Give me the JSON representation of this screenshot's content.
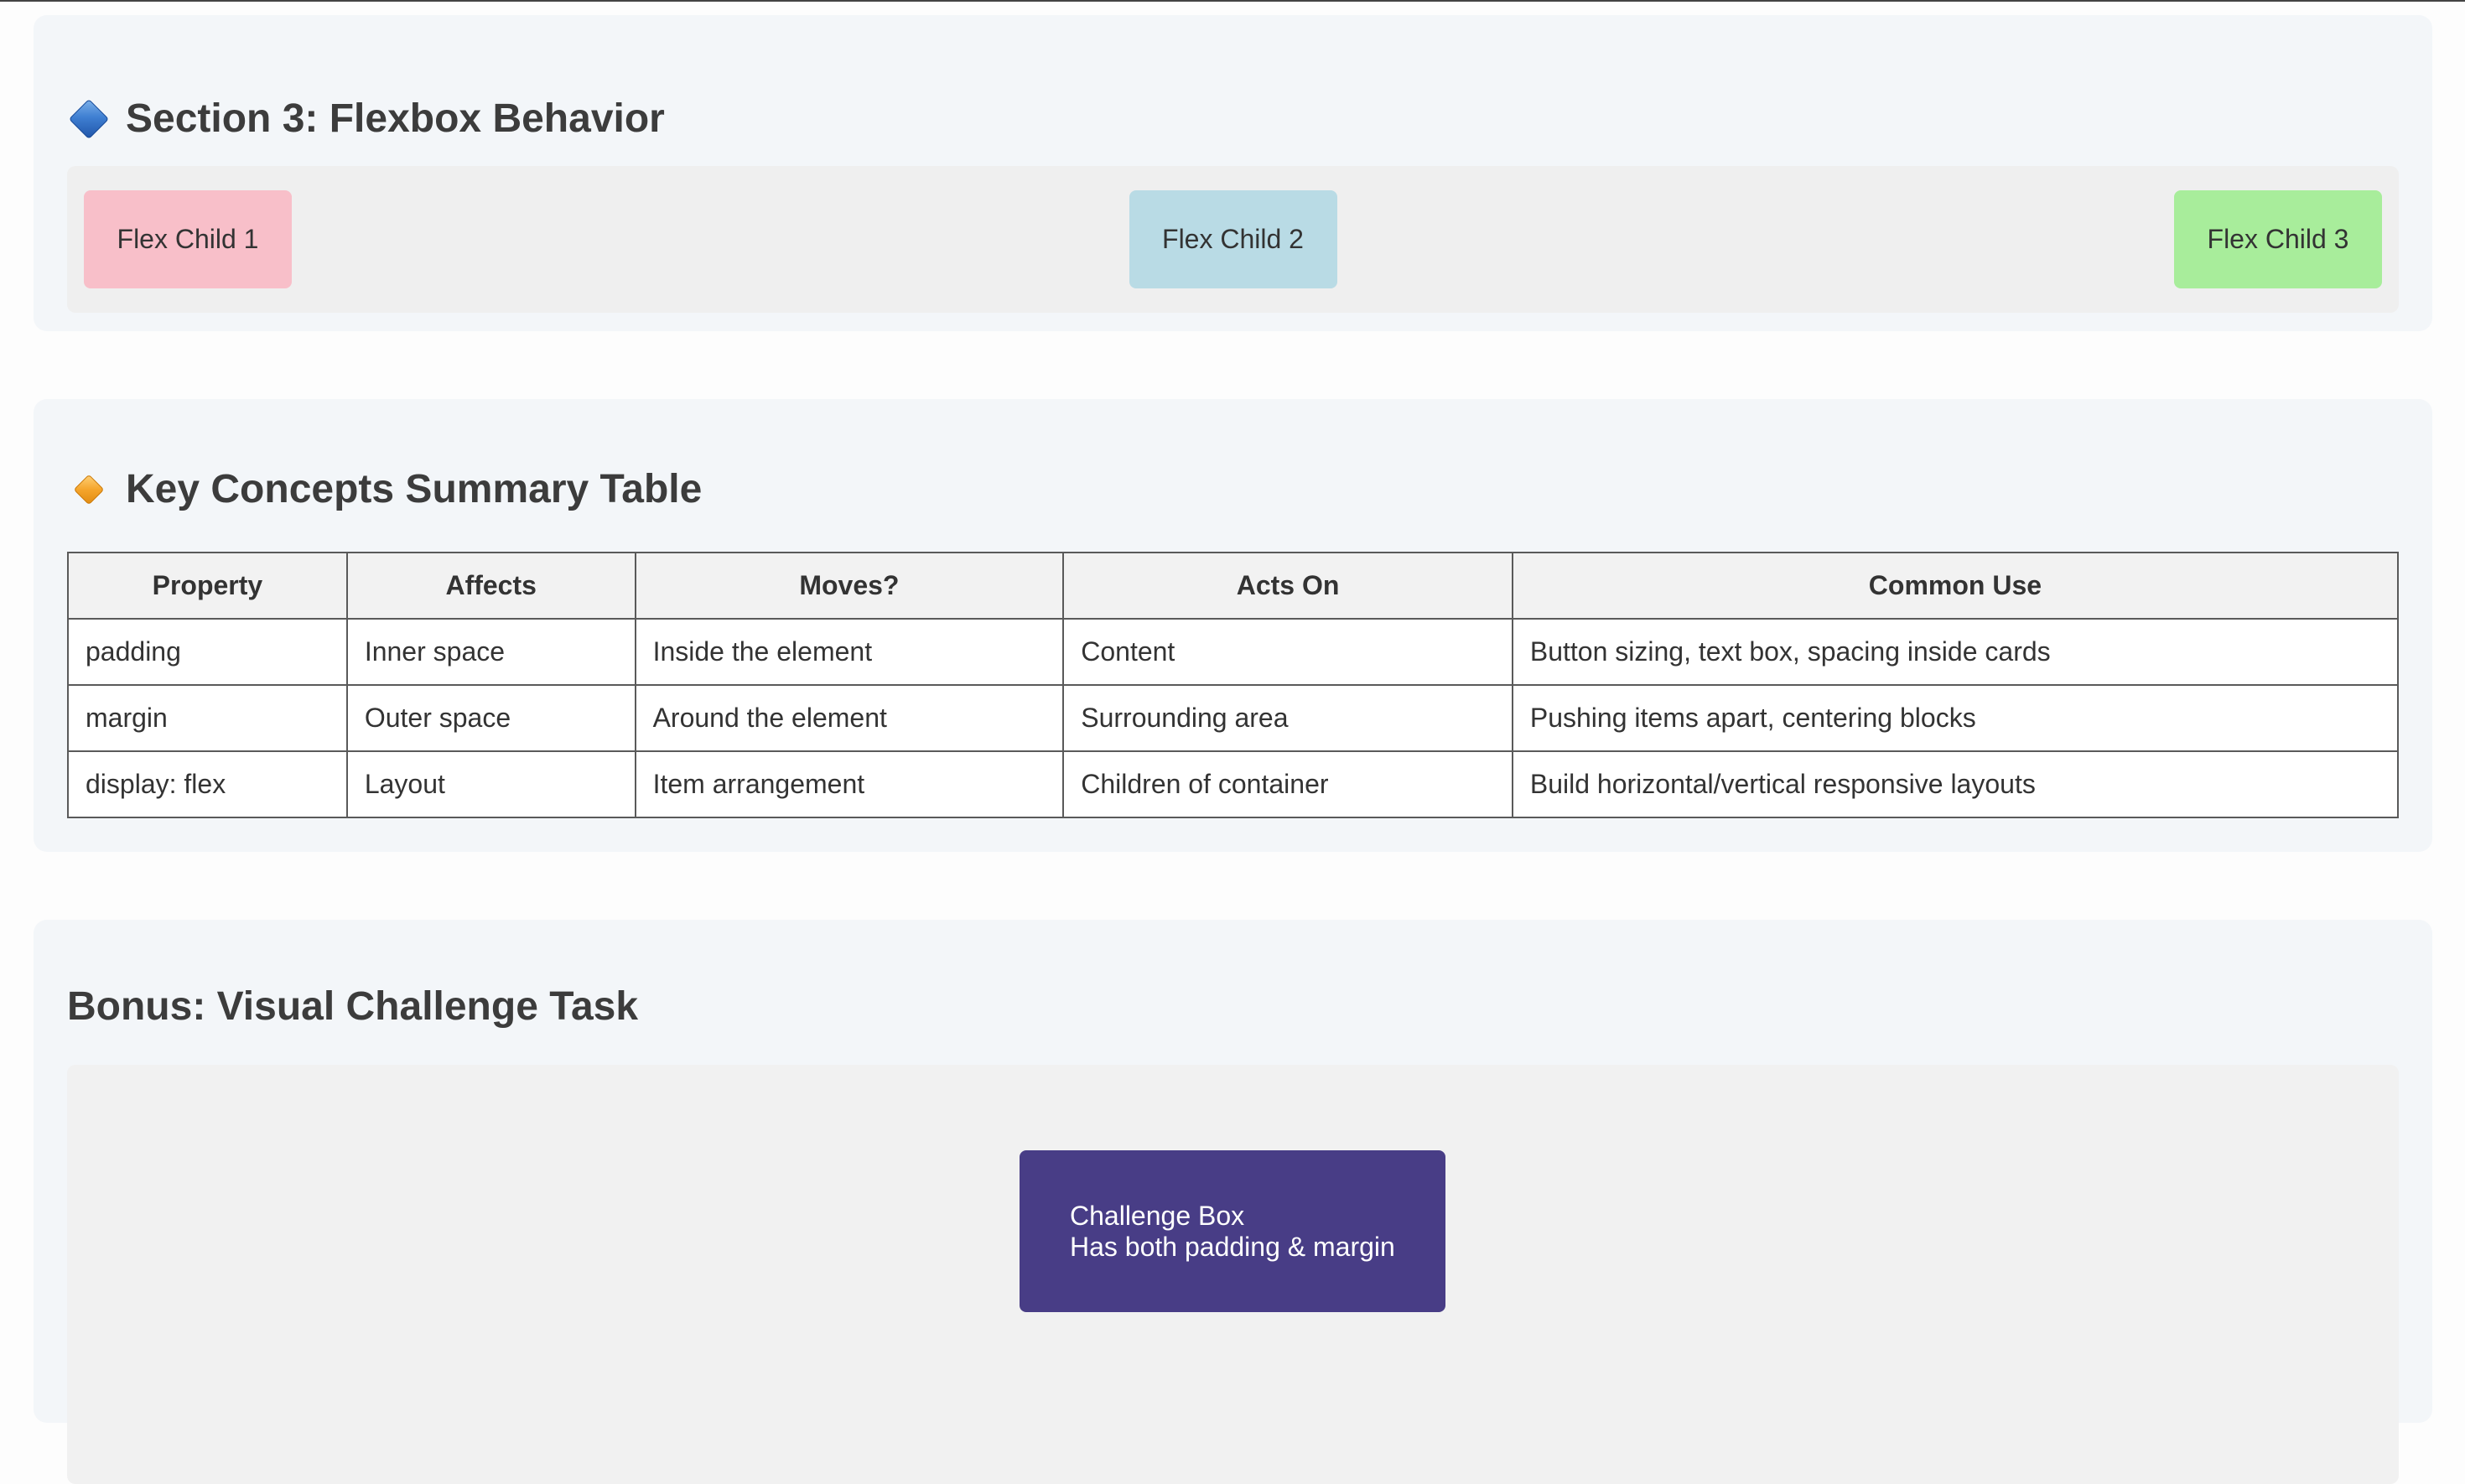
{
  "flexbox_section": {
    "title": "Section 3: Flexbox Behavior",
    "title_icon": "blue-diamond-icon",
    "children": [
      {
        "label": "Flex Child 1",
        "color": "#f8bfc9"
      },
      {
        "label": "Flex Child 2",
        "color": "#b9dbe5"
      },
      {
        "label": "Flex Child 3",
        "color": "#a8ed9b"
      }
    ]
  },
  "summary_section": {
    "title": "Key Concepts Summary Table",
    "title_icon": "orange-diamond-icon",
    "table": {
      "headers": [
        "Property",
        "Affects",
        "Moves?",
        "Acts On",
        "Common Use"
      ],
      "rows": [
        [
          "padding",
          "Inner space",
          "Inside the element",
          "Content",
          "Button sizing, text box, spacing inside cards"
        ],
        [
          "margin",
          "Outer space",
          "Around the element",
          "Surrounding area",
          "Pushing items apart, centering blocks"
        ],
        [
          "display: flex",
          "Layout",
          "Item arrangement",
          "Children of container",
          "Build horizontal/vertical responsive layouts"
        ]
      ]
    }
  },
  "bonus_section": {
    "title": "Bonus: Visual Challenge Task",
    "challenge_box": {
      "line1": "Challenge Box",
      "line2": "Has both padding & margin",
      "color": "#483d86"
    }
  }
}
